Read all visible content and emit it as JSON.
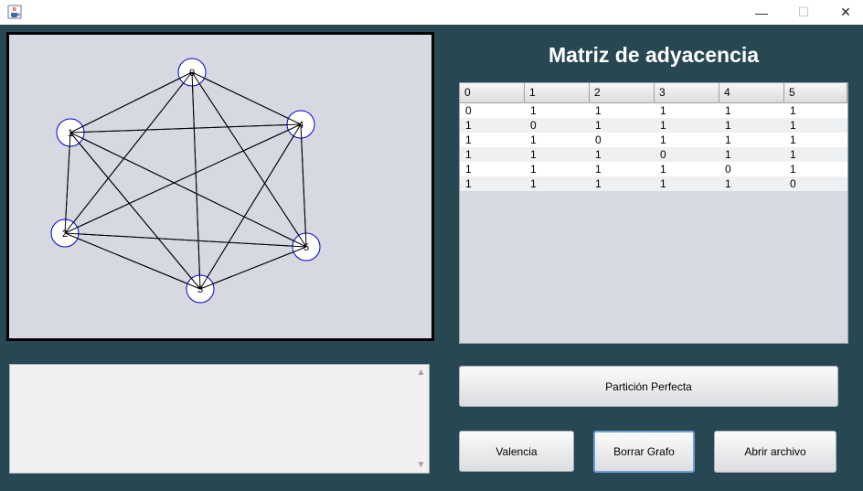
{
  "window": {
    "app_icon": "java-cup-icon",
    "minimize_glyph": "—",
    "maximize_glyph": "☐",
    "close_glyph": "✕"
  },
  "graph": {
    "nodes": [
      {
        "label": "0"
      },
      {
        "label": "1"
      },
      {
        "label": "4"
      },
      {
        "label": "2"
      },
      {
        "label": "5"
      },
      {
        "label": "3"
      }
    ],
    "node_color": "#0000cc",
    "edge_color": "#000000",
    "edges": [
      [
        0,
        1
      ],
      [
        0,
        2
      ],
      [
        0,
        3
      ],
      [
        0,
        4
      ],
      [
        0,
        5
      ],
      [
        1,
        2
      ],
      [
        1,
        3
      ],
      [
        1,
        4
      ],
      [
        1,
        5
      ],
      [
        2,
        3
      ],
      [
        2,
        4
      ],
      [
        2,
        5
      ],
      [
        3,
        4
      ],
      [
        3,
        5
      ],
      [
        4,
        5
      ]
    ]
  },
  "matrix": {
    "title": "Matriz de adyacencia",
    "headers": [
      "0",
      "1",
      "2",
      "3",
      "4",
      "5"
    ],
    "rows": [
      [
        "0",
        "1",
        "1",
        "1",
        "1",
        "1"
      ],
      [
        "1",
        "0",
        "1",
        "1",
        "1",
        "1"
      ],
      [
        "1",
        "1",
        "0",
        "1",
        "1",
        "1"
      ],
      [
        "1",
        "1",
        "1",
        "0",
        "1",
        "1"
      ],
      [
        "1",
        "1",
        "1",
        "1",
        "0",
        "1"
      ],
      [
        "1",
        "1",
        "1",
        "1",
        "1",
        "0"
      ]
    ]
  },
  "output_text": "",
  "buttons": {
    "perfect_partition": "Partición Perfecta",
    "valence": "Valencia",
    "clear_graph": "Borrar Grafo",
    "open_file": "Abrir archivo"
  },
  "scroll_up_glyph": "▲",
  "scroll_down_glyph": "▼"
}
